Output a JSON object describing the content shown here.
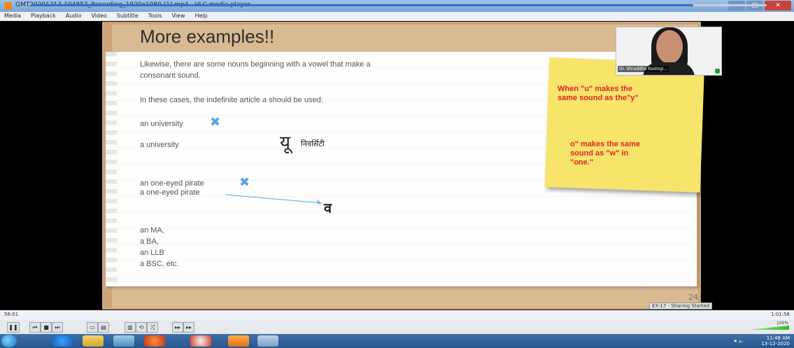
{
  "window": {
    "title": "GMT20201213-104857_Recording_1920x1080 (1).mp4 - VLC media player",
    "controls": [
      "–",
      "□",
      "✕"
    ]
  },
  "menu": [
    "Media",
    "Playback",
    "Audio",
    "Video",
    "Subtitle",
    "Tools",
    "View",
    "Help"
  ],
  "slide": {
    "title": "More examples!!",
    "line1": "Likewise, there are some nouns beginning with a vowel that make a",
    "line2": "consonant sound.",
    "line3a": "In these cases, the indefinite article",
    "line3b": "a",
    "line3c": "should be used:",
    "ex1": "an university",
    "ex2": "a university",
    "ex3": "an one-eyed pirate",
    "ex4": "a one-eyed pirate",
    "ex5": "an MA,",
    "ex6": "a BA,",
    "ex7": "an LLB",
    "ex8": "a BSC, etc.",
    "wrong_mark": "✖",
    "hindi_yu": "यू",
    "hindi_university": "निवर्सिटी",
    "hindi_va": "व",
    "slide_number": "24"
  },
  "sticky": {
    "note1_line1": "When \"u\" makes the",
    "note1_line2": "same sound as the\"y\"",
    "note2_line1": "o\" makes the same",
    "note2_line2": "sound as \"w\" in",
    "note2_line3": "\"one.\""
  },
  "webcam": {
    "label": "Dr. Shraddha Rastogi..."
  },
  "share_tag": "EX-17 - Sharing Started",
  "player": {
    "elapsed": "56:01",
    "total": "1:01:56",
    "progress": 0.9,
    "volume_label": "100%"
  },
  "controls": [
    "❚❚",
    "⏮",
    "■",
    "⏭",
    "▭",
    "▤",
    "▥",
    "⟲",
    "⤮",
    "▸▸",
    "▸▸"
  ],
  "taskbar": {
    "time": "11:48 AM",
    "date": "13-12-2020"
  },
  "colors": {
    "sticky": "#f7e46a",
    "note_text": "#e12424",
    "cross": "#5aa2e0",
    "seek_fill": "#2f6fcf"
  }
}
